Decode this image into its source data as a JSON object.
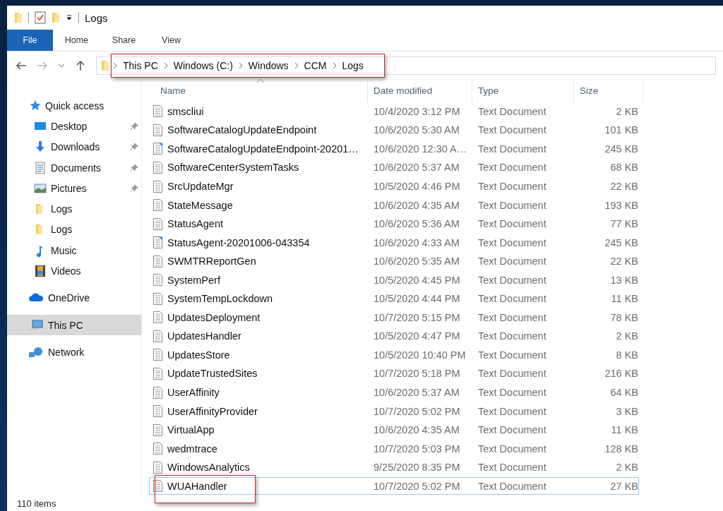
{
  "window": {
    "title": "Logs"
  },
  "ribbon_tabs": [
    {
      "label": "File",
      "selected": true
    },
    {
      "label": "Home",
      "selected": false
    },
    {
      "label": "Share",
      "selected": false
    },
    {
      "label": "View",
      "selected": false
    }
  ],
  "address": {
    "highlighted": true,
    "crumbs": [
      "This PC",
      "Windows (C:)",
      "Windows",
      "CCM",
      "Logs"
    ]
  },
  "sidebar": {
    "items": [
      {
        "label": "Quick access",
        "kind": "star",
        "pinned": false,
        "selected": false,
        "children": [
          {
            "label": "Desktop",
            "kind": "desktop",
            "pinned": true,
            "selected": false
          },
          {
            "label": "Downloads",
            "kind": "download",
            "pinned": true,
            "selected": false
          },
          {
            "label": "Documents",
            "kind": "document",
            "pinned": true,
            "selected": false
          },
          {
            "label": "Pictures",
            "kind": "picture",
            "pinned": true,
            "selected": false
          },
          {
            "label": "Logs",
            "kind": "folder",
            "pinned": false,
            "selected": false
          },
          {
            "label": "Logs",
            "kind": "folder",
            "pinned": false,
            "selected": false
          },
          {
            "label": "Music",
            "kind": "music",
            "pinned": false,
            "selected": false
          },
          {
            "label": "Videos",
            "kind": "video",
            "pinned": false,
            "selected": false
          }
        ]
      },
      {
        "label": "OneDrive",
        "kind": "cloud",
        "pinned": false,
        "selected": false
      },
      {
        "label": "This PC",
        "kind": "pc",
        "pinned": false,
        "selected": true
      },
      {
        "label": "Network",
        "kind": "network",
        "pinned": false,
        "selected": false
      }
    ]
  },
  "table": {
    "columns": [
      "Name",
      "Date modified",
      "Type",
      "Size"
    ],
    "rows": [
      {
        "name": "smscliui",
        "date": "10/4/2020 3:12 PM",
        "type": "Text Document",
        "size": "2 KB",
        "kind": "text",
        "focused": false,
        "highlighted": false
      },
      {
        "name": "SoftwareCatalogUpdateEndpoint",
        "date": "10/6/2020 5:30 AM",
        "type": "Text Document",
        "size": "101 KB",
        "kind": "text",
        "focused": false,
        "highlighted": false
      },
      {
        "name": "SoftwareCatalogUpdateEndpoint-20201…",
        "date": "10/6/2020 12:30 A…",
        "type": "Text Document",
        "size": "245 KB",
        "kind": "edited",
        "focused": false,
        "highlighted": false
      },
      {
        "name": "SoftwareCenterSystemTasks",
        "date": "10/6/2020 5:37 AM",
        "type": "Text Document",
        "size": "68 KB",
        "kind": "text",
        "focused": false,
        "highlighted": false
      },
      {
        "name": "SrcUpdateMgr",
        "date": "10/5/2020 4:46 PM",
        "type": "Text Document",
        "size": "22 KB",
        "kind": "text",
        "focused": false,
        "highlighted": false
      },
      {
        "name": "StateMessage",
        "date": "10/6/2020 4:35 AM",
        "type": "Text Document",
        "size": "193 KB",
        "kind": "text",
        "focused": false,
        "highlighted": false
      },
      {
        "name": "StatusAgent",
        "date": "10/6/2020 5:36 AM",
        "type": "Text Document",
        "size": "77 KB",
        "kind": "text",
        "focused": false,
        "highlighted": false
      },
      {
        "name": "StatusAgent-20201006-043354",
        "date": "10/6/2020 4:33 AM",
        "type": "Text Document",
        "size": "245 KB",
        "kind": "edited",
        "focused": false,
        "highlighted": false
      },
      {
        "name": "SWMTRReportGen",
        "date": "10/6/2020 5:35 AM",
        "type": "Text Document",
        "size": "22 KB",
        "kind": "text",
        "focused": false,
        "highlighted": false
      },
      {
        "name": "SystemPerf",
        "date": "10/5/2020 4:45 PM",
        "type": "Text Document",
        "size": "13 KB",
        "kind": "text",
        "focused": false,
        "highlighted": false
      },
      {
        "name": "SystemTempLockdown",
        "date": "10/5/2020 4:44 PM",
        "type": "Text Document",
        "size": "11 KB",
        "kind": "text",
        "focused": false,
        "highlighted": false
      },
      {
        "name": "UpdatesDeployment",
        "date": "10/7/2020 5:15 PM",
        "type": "Text Document",
        "size": "78 KB",
        "kind": "text",
        "focused": false,
        "highlighted": false
      },
      {
        "name": "UpdatesHandler",
        "date": "10/5/2020 4:47 PM",
        "type": "Text Document",
        "size": "2 KB",
        "kind": "text",
        "focused": false,
        "highlighted": false
      },
      {
        "name": "UpdatesStore",
        "date": "10/5/2020 10:40 PM",
        "type": "Text Document",
        "size": "8 KB",
        "kind": "text",
        "focused": false,
        "highlighted": false
      },
      {
        "name": "UpdateTrustedSites",
        "date": "10/7/2020 5:18 PM",
        "type": "Text Document",
        "size": "216 KB",
        "kind": "text",
        "focused": false,
        "highlighted": false
      },
      {
        "name": "UserAffinity",
        "date": "10/6/2020 5:37 AM",
        "type": "Text Document",
        "size": "64 KB",
        "kind": "text",
        "focused": false,
        "highlighted": false
      },
      {
        "name": "UserAffinityProvider",
        "date": "10/7/2020 5:02 PM",
        "type": "Text Document",
        "size": "3 KB",
        "kind": "text",
        "focused": false,
        "highlighted": false
      },
      {
        "name": "VirtualApp",
        "date": "10/6/2020 4:35 AM",
        "type": "Text Document",
        "size": "11 KB",
        "kind": "text",
        "focused": false,
        "highlighted": false
      },
      {
        "name": "wedmtrace",
        "date": "10/7/2020 5:03 PM",
        "type": "Text Document",
        "size": "128 KB",
        "kind": "text",
        "focused": false,
        "highlighted": false
      },
      {
        "name": "WindowsAnalytics",
        "date": "9/25/2020 8:35 PM",
        "type": "Text Document",
        "size": "2 KB",
        "kind": "text",
        "focused": false,
        "highlighted": false
      },
      {
        "name": "WUAHandler",
        "date": "10/7/2020 5:02 PM",
        "type": "Text Document",
        "size": "27 KB",
        "kind": "text",
        "focused": true,
        "highlighted": true
      }
    ]
  },
  "status_bar": {
    "text": "110 items"
  }
}
